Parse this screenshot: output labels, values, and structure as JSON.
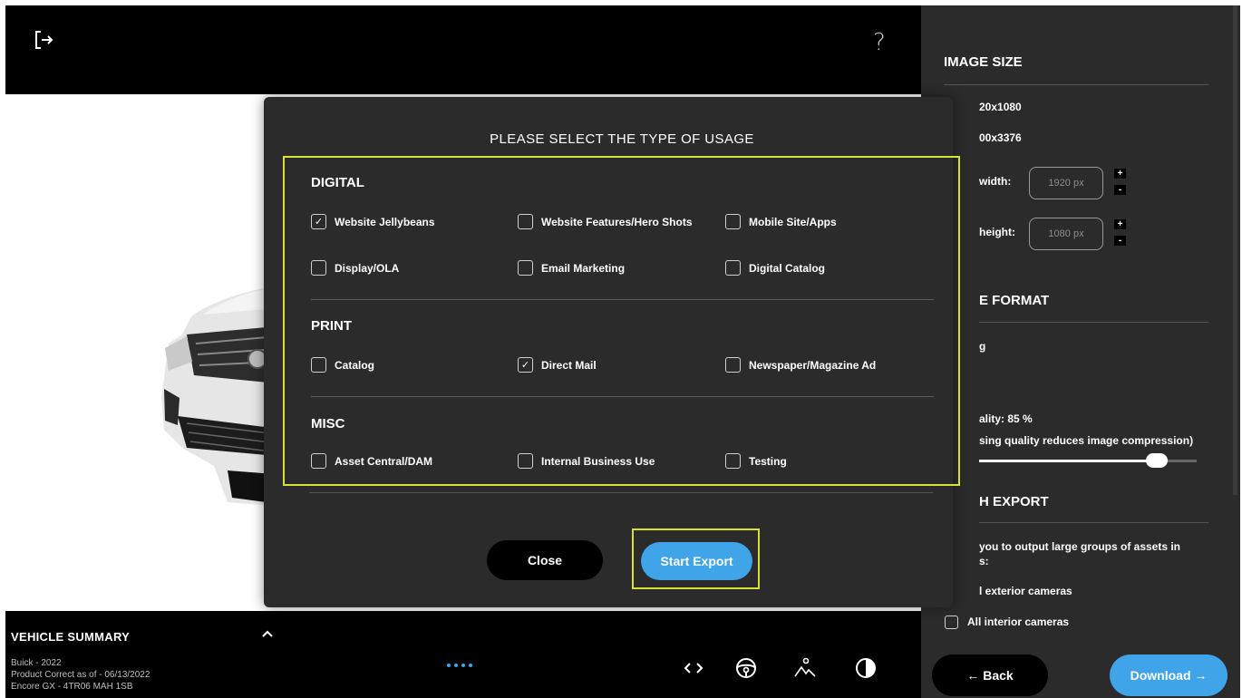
{
  "modal": {
    "title": "PLEASE SELECT THE TYPE OF USAGE",
    "sections": [
      {
        "heading": "DIGITAL",
        "options": [
          {
            "label": "Website Jellybeans",
            "checked": true
          },
          {
            "label": "Website Features/Hero Shots",
            "checked": false
          },
          {
            "label": "Mobile Site/Apps",
            "checked": false
          },
          {
            "label": "Display/OLA",
            "checked": false
          },
          {
            "label": "Email Marketing",
            "checked": false
          },
          {
            "label": "Digital Catalog",
            "checked": false
          }
        ]
      },
      {
        "heading": "PRINT",
        "options": [
          {
            "label": "Catalog",
            "checked": false
          },
          {
            "label": "Direct Mail",
            "checked": true
          },
          {
            "label": "Newspaper/Magazine Ad",
            "checked": false
          }
        ]
      },
      {
        "heading": "MISC",
        "options": [
          {
            "label": "Asset Central/DAM",
            "checked": false
          },
          {
            "label": "Internal Business Use",
            "checked": false
          },
          {
            "label": "Testing",
            "checked": false
          }
        ]
      }
    ],
    "close_label": "Close",
    "export_label": "Start Export",
    "check_glyph": "✓"
  },
  "top_bar": {
    "help_glyph": "?"
  },
  "vehicle_summary": {
    "title": "VEHICLE SUMMARY",
    "line1": "Buick - 2022",
    "line2": "Product Correct as of - 06/13/2022",
    "line3": "Encore GX - 4TR06 MAH 1SB"
  },
  "side_panel": {
    "image_size_heading": "IMAGE SIZE",
    "size_option_1": "20x1080",
    "size_option_2": "00x3376",
    "width_label": "width:",
    "width_value": "1920 px",
    "height_label": "height:",
    "height_value": "1080 px",
    "stepper_plus": "+",
    "stepper_minus": "-",
    "format_heading": "E FORMAT",
    "format_option_1": "g",
    "quality_label": "ality:",
    "quality_value": "85 %",
    "quality_percent": 85,
    "quality_note": "sing quality reduces image compression)",
    "batch_heading": "H EXPORT",
    "batch_desc_1": "you to output large groups of assets in",
    "batch_desc_2": "s:",
    "exterior_label": "l exterior cameras",
    "interior_label": "All interior cameras",
    "back_label": "← Back",
    "download_label": "Download →"
  },
  "colors": {
    "accent_blue": "#3fa4e8",
    "highlight_yellow": "#d6e233",
    "panel_gray": "#2b2b2b"
  }
}
